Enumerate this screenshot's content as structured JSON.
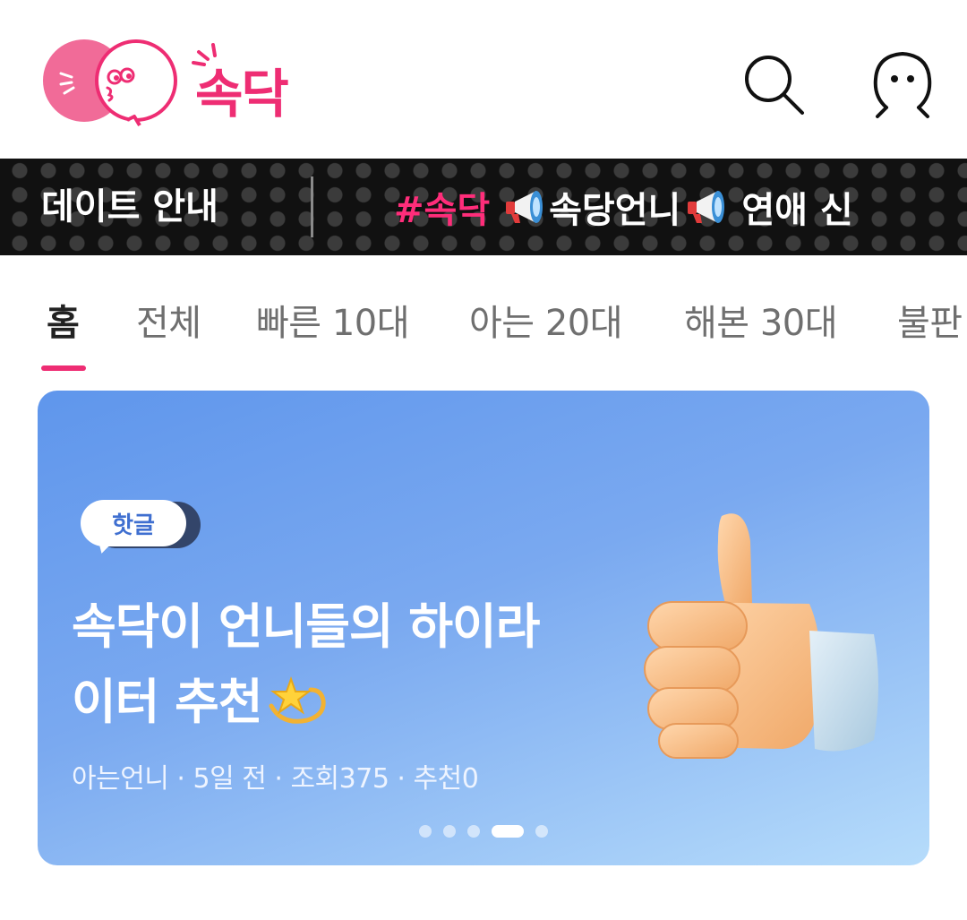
{
  "header": {
    "logo_text": "속닥",
    "search_icon": "search-icon",
    "profile_icon": "profile-icon"
  },
  "notice": {
    "label": "데이트 안내",
    "ticker_tag": "#속닥",
    "ticker_items": [
      "속당언니",
      "연애 신"
    ],
    "ticker_icon": "megaphone-icon"
  },
  "tabs": [
    {
      "label": "홈",
      "active": true
    },
    {
      "label": "전체"
    },
    {
      "label": "빠른 10대"
    },
    {
      "label": "아는 20대"
    },
    {
      "label": "해본 30대"
    },
    {
      "label": "불판"
    }
  ],
  "banner": {
    "badge": "핫글",
    "title_line1": "속닥이 언니들의 하이라",
    "title_line2": "이터 추천",
    "meta": "아는언니 · 5일 전 · 조회375 · 추천0",
    "slide_count": 5,
    "active_slide": 4
  },
  "colors": {
    "brand_pink": "#ee2d73",
    "notice_bg": "#111111",
    "banner_blue": "#6a9ff0",
    "tab_active": "#222222",
    "tab_inactive": "#6f6f6f"
  }
}
